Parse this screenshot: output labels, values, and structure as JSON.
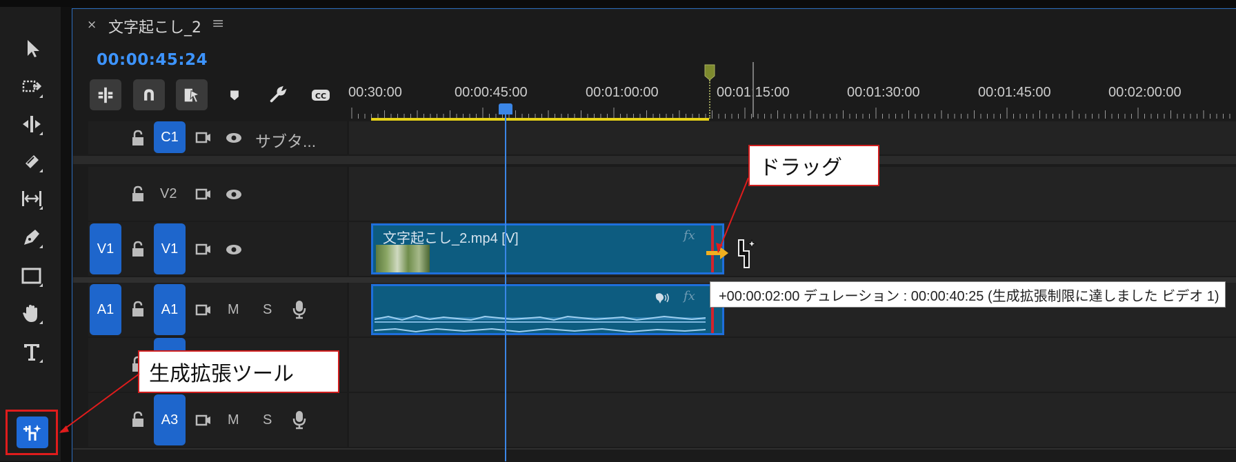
{
  "sequence": {
    "tab_close": "×",
    "tab_title": "文字起こし_2",
    "tab_menu": "≡",
    "timecode": "00:00:45:24"
  },
  "toolbar": {
    "tools": [
      {
        "name": "selection-tool",
        "icon": "arrow-icon"
      },
      {
        "name": "track-select-tool",
        "icon": "track-select-icon"
      },
      {
        "name": "ripple-edit-tool",
        "icon": "ripple-edit-icon"
      },
      {
        "name": "razor-tool",
        "icon": "razor-icon"
      },
      {
        "name": "slip-tool",
        "icon": "slip-icon"
      },
      {
        "name": "pen-tool",
        "icon": "pen-icon"
      },
      {
        "name": "rectangle-tool",
        "icon": "rectangle-icon"
      },
      {
        "name": "hand-tool",
        "icon": "hand-icon"
      },
      {
        "name": "type-tool",
        "icon": "type-icon"
      },
      {
        "name": "generative-extend-tool",
        "icon": "generative-extend-icon",
        "active": true
      }
    ]
  },
  "timeline_buttons": [
    {
      "name": "insert-nest-button",
      "icon": "nest-icon"
    },
    {
      "name": "snap-button",
      "icon": "magnet-icon"
    },
    {
      "name": "linked-selection-button",
      "icon": "linked-icon"
    },
    {
      "name": "add-marker-button",
      "icon": "marker-icon"
    },
    {
      "name": "timeline-settings-button",
      "icon": "wrench-icon"
    },
    {
      "name": "captions-button",
      "icon": "cc-icon"
    }
  ],
  "ruler": {
    "labels": [
      "00:30:00",
      "00:00:45:00",
      "00:01:00:00",
      "00:01:15:00",
      "00:01:30:00",
      "00:01:45:00",
      "00:02:00:00"
    ]
  },
  "tracks": {
    "c1": {
      "tag": "C1",
      "name": "サブタ..."
    },
    "v2": {
      "tag": "V2"
    },
    "v1": {
      "source": "V1",
      "tag": "V1"
    },
    "a1": {
      "source": "A1",
      "tag": "A1",
      "m": "M",
      "s": "S"
    },
    "a3": {
      "tag": "A3",
      "m": "M",
      "s": "S"
    }
  },
  "clips": {
    "video_title": "文字起こし_2.mp4 [V]",
    "fx": "fx"
  },
  "tooltip": "+00:00:02:00 デュレーション : 00:00:40:25 (生成拡張制限に達しました ビデオ 1)",
  "callouts": {
    "drag": "ドラッグ",
    "tool": "生成拡張ツール"
  },
  "colors": {
    "accent": "#1e66cc",
    "timecode": "#3d94ff",
    "clip": "#0d5c80",
    "callout_border": "#d01e1e",
    "work_area": "#e6d21a",
    "drag_arrow": "#f0b020"
  }
}
